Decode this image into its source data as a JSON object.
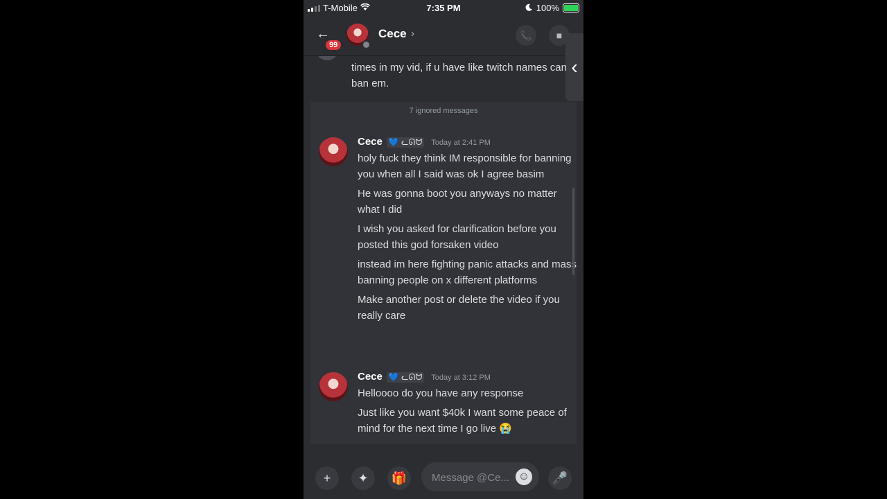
{
  "status_bar": {
    "carrier": "T-Mobile",
    "time": "7:35 PM",
    "battery": "100%",
    "wifi_icon": "wifi-icon",
    "moon_icon": "moon-icon"
  },
  "header": {
    "back_icon": "←",
    "unread_badge": "99",
    "title": "Cece",
    "chevron": "›",
    "call_icon": "📞",
    "video_icon": "■",
    "side_tab": "‹"
  },
  "chat": {
    "previous_text": "times in my vid, if u have like twitch names can ban em.",
    "ignored_label": "7 ignored messages",
    "messages": [
      {
        "author": "Cece",
        "tag": "💙 ᓚᘏᗢ",
        "timestamp": "Today at 2:41 PM",
        "lines": [
          "holy fuck they think IM responsible for banning you when all I said was ok I agree basim",
          "He was gonna boot you anyways no matter what I did",
          "I wish you asked for clarification before you posted this god forsaken video",
          "instead im here fighting panic attacks and mass banning people on x different platforms",
          "Make another post or delete the video if you really care"
        ]
      },
      {
        "author": "Cece",
        "tag": "💙 ᓚᘏᗢ",
        "timestamp": "Today at 3:12 PM",
        "lines": [
          "Helloooo do you have any response",
          "Just like you want $40k I want some peace of mind for the next time I go live 😭"
        ]
      }
    ]
  },
  "composer": {
    "plus_icon": "+",
    "apps_icon": "✦",
    "gift_icon": "🎁",
    "placeholder": "Message @Ce...",
    "emoji_icon": "☺",
    "mic_icon": "🎤"
  }
}
